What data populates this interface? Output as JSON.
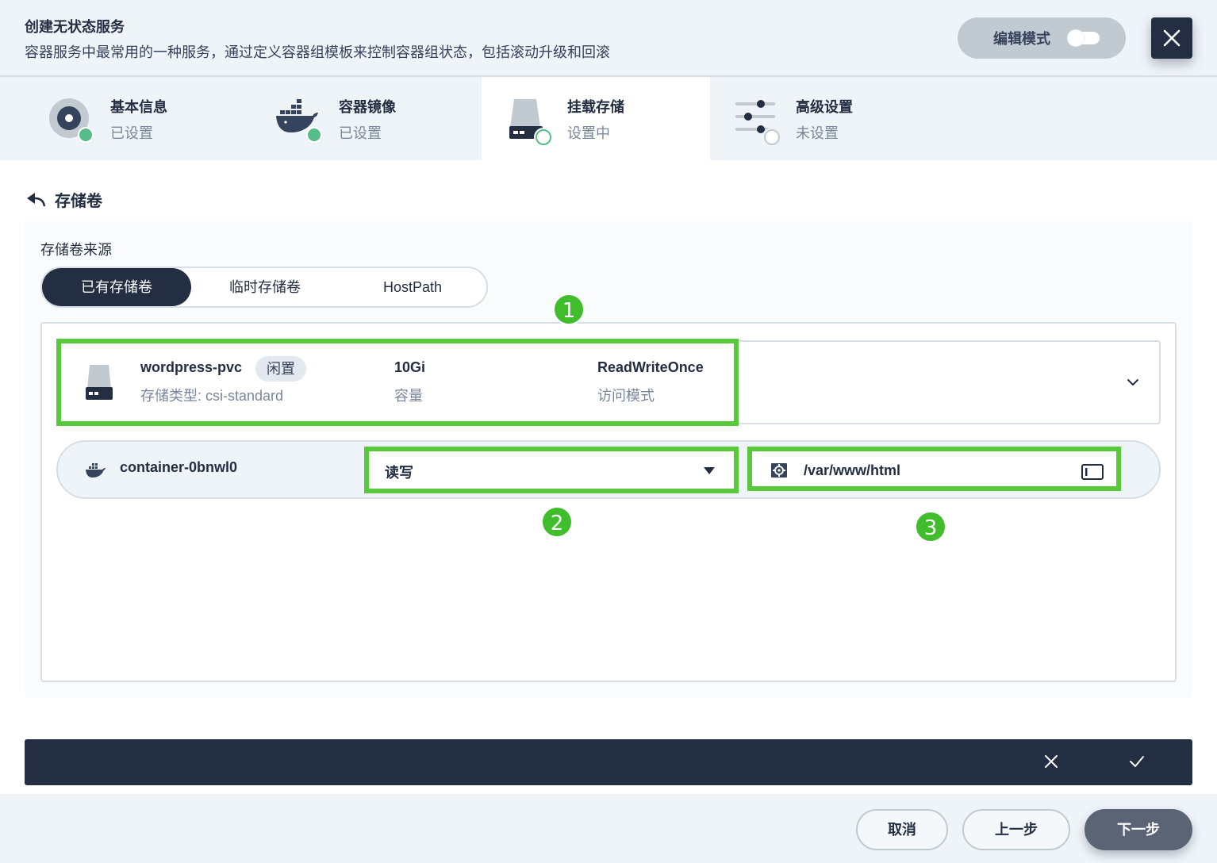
{
  "header": {
    "title": "创建无状态服务",
    "description": "容器服务中最常用的一种服务，通过定义容器组模板来控制容器组状态，包括滚动升级和回滚",
    "edit_mode_label": "编辑模式"
  },
  "steps": [
    {
      "title": "基本信息",
      "status": "已设置"
    },
    {
      "title": "容器镜像",
      "status": "已设置"
    },
    {
      "title": "挂载存储",
      "status": "设置中"
    },
    {
      "title": "高级设置",
      "status": "未设置"
    }
  ],
  "section": {
    "title": "存储卷"
  },
  "source": {
    "label": "存储卷来源",
    "options": [
      "已有存储卷",
      "临时存储卷",
      "HostPath"
    ],
    "selected": "已有存储卷"
  },
  "pvc": {
    "name": "wordpress-pvc",
    "badge": "闲置",
    "type_text": "存储类型: csi-standard",
    "capacity": "10Gi",
    "capacity_label": "容量",
    "access_mode": "ReadWriteOnce",
    "access_mode_label": "访问模式"
  },
  "mount": {
    "container_name": "container-0bnwl0",
    "permission": "读写",
    "path": "/var/www/html"
  },
  "annotations": [
    "1",
    "2",
    "3"
  ],
  "footer": {
    "cancel": "取消",
    "prev": "上一步",
    "next": "下一步"
  },
  "colors": {
    "dark": "#242e42",
    "success": "#55bc8a",
    "highlight": "#57c93a",
    "background": "#eff4f9"
  }
}
